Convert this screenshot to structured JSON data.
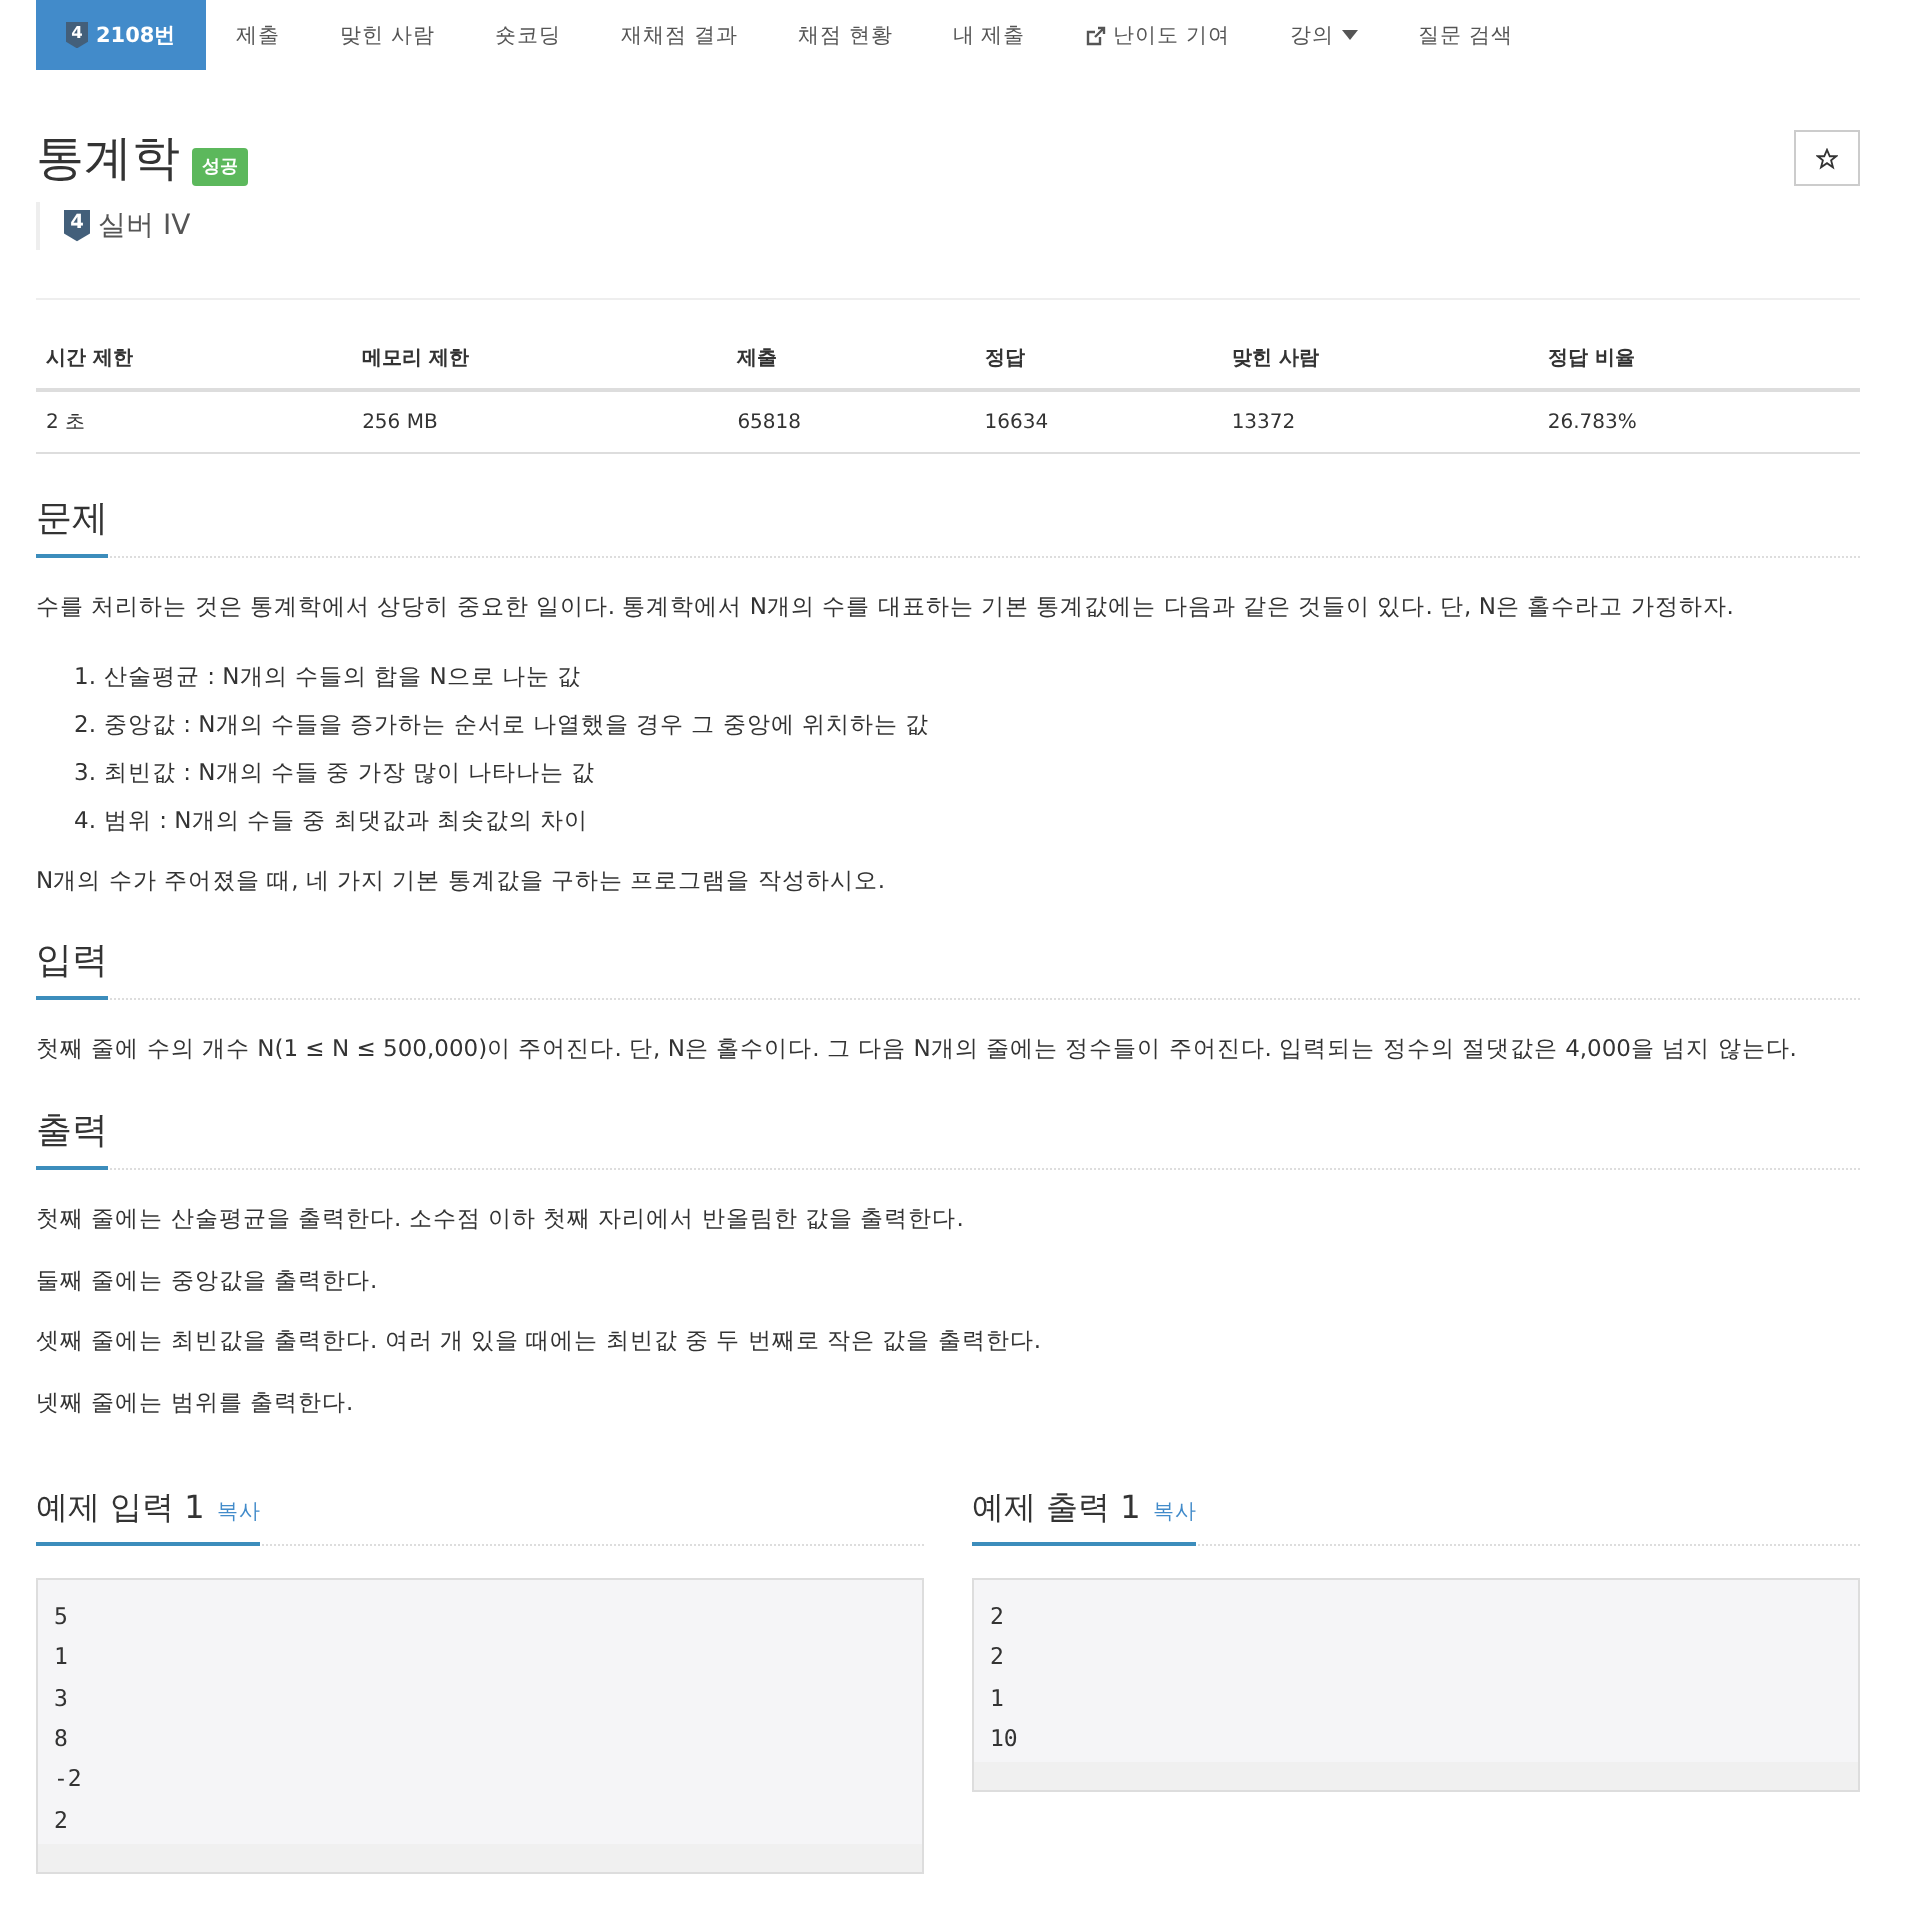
{
  "nav": {
    "tier": "4",
    "items": [
      {
        "label": "2108번",
        "selected": true,
        "kind": "problem"
      },
      {
        "label": "제출",
        "selected": false,
        "kind": "link"
      },
      {
        "label": "맞힌 사람",
        "selected": false,
        "kind": "link"
      },
      {
        "label": "숏코딩",
        "selected": false,
        "kind": "link"
      },
      {
        "label": "재채점 결과",
        "selected": false,
        "kind": "link"
      },
      {
        "label": "채점 현황",
        "selected": false,
        "kind": "link"
      },
      {
        "label": "내 제출",
        "selected": false,
        "kind": "link"
      },
      {
        "label": "난이도 기여",
        "selected": false,
        "kind": "external"
      },
      {
        "label": "강의",
        "selected": false,
        "kind": "dropdown"
      },
      {
        "label": "질문 검색",
        "selected": false,
        "kind": "link"
      }
    ]
  },
  "title": "통계학",
  "status_badge": "성공",
  "tier": {
    "digit": "4",
    "label": "실버 IV"
  },
  "info_table": {
    "columns": [
      "시간 제한",
      "메모리 제한",
      "제출",
      "정답",
      "맞힌 사람",
      "정답 비율"
    ],
    "rows": [
      [
        "2 초",
        "256 MB",
        "65818",
        "16634",
        "13372",
        "26.783%"
      ]
    ]
  },
  "sections": [
    {
      "heading": "문제",
      "blocks": [
        {
          "kind": "para",
          "text": "수를 처리하는 것은 통계학에서 상당히 중요한 일이다. 통계학에서 N개의 수를 대표하는 기본 통계값에는 다음과 같은 것들이 있다. 단, N은 홀수라고 가정하자."
        },
        {
          "kind": "list",
          "items": [
            {
              "marker": "1.",
              "text": "산술평균 : N개의 수들의 합을 N으로 나눈 값"
            },
            {
              "marker": "2.",
              "text": "중앙값 : N개의 수들을 증가하는 순서로 나열했을 경우 그 중앙에 위치하는 값"
            },
            {
              "marker": "3.",
              "text": "최빈값 : N개의 수들 중 가장 많이 나타나는 값"
            },
            {
              "marker": "4.",
              "text": "범위 : N개의 수들 중 최댓값과 최솟값의 차이"
            }
          ]
        },
        {
          "kind": "para",
          "text": "N개의 수가 주어졌을 때, 네 가지 기본 통계값을 구하는 프로그램을 작성하시오."
        }
      ]
    },
    {
      "heading": "입력",
      "blocks": [
        {
          "kind": "para",
          "text": "첫째 줄에 수의 개수 N(1 ≤ N ≤ 500,000)이 주어진다. 단, N은 홀수이다. 그 다음 N개의 줄에는 정수들이 주어진다. 입력되는 정수의 절댓값은 4,000을 넘지 않는다."
        }
      ]
    },
    {
      "heading": "출력",
      "blocks": [
        {
          "kind": "para",
          "text": "첫째 줄에는 산술평균을 출력한다. 소수점 이하 첫째 자리에서 반올림한 값을 출력한다."
        },
        {
          "kind": "para",
          "text": "둘째 줄에는 중앙값을 출력한다."
        },
        {
          "kind": "para",
          "text": "셋째 줄에는 최빈값을 출력한다. 여러 개 있을 때에는 최빈값 중 두 번째로 작은 값을 출력한다."
        },
        {
          "kind": "para",
          "text": "넷째 줄에는 범위를 출력한다."
        }
      ]
    }
  ],
  "samples": [
    {
      "heading": "예제 입력 1",
      "copy": "복사",
      "lines": [
        "5",
        "1",
        "3",
        "8",
        "-2",
        "2"
      ]
    },
    {
      "heading": "예제 출력 1",
      "copy": "복사",
      "lines": [
        "2",
        "2",
        "1",
        "10"
      ]
    }
  ]
}
